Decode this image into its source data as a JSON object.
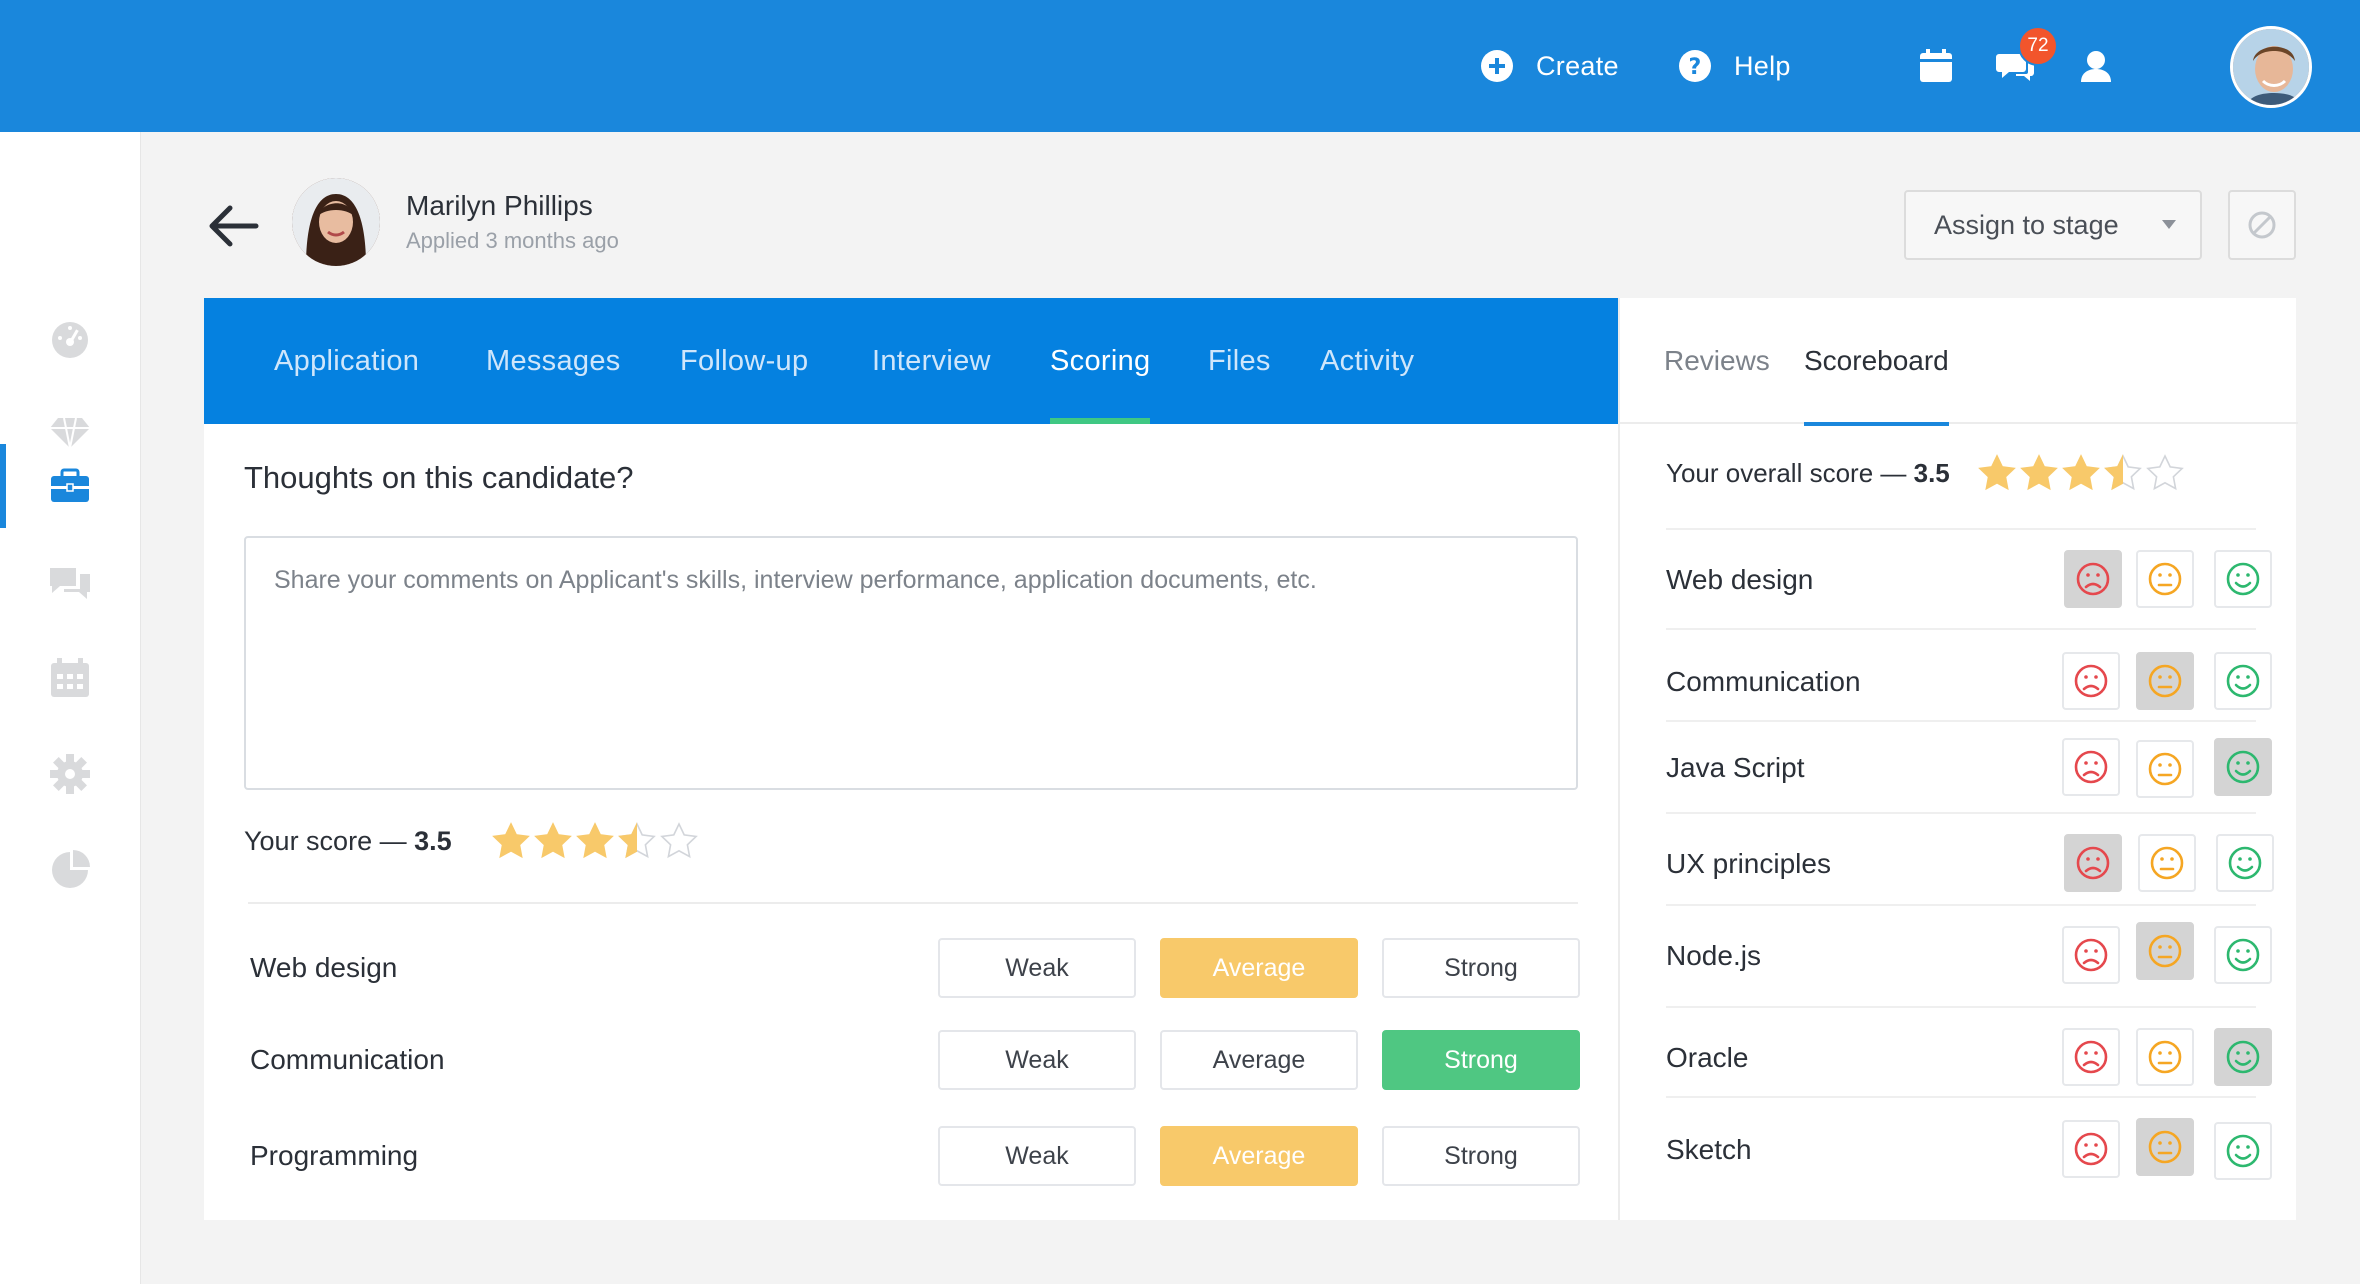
{
  "topbar": {
    "create_label": "Create",
    "help_label": "Help",
    "notification_count": "72"
  },
  "candidate": {
    "name": "Marilyn Phillips",
    "applied": "Applied 3 months ago"
  },
  "header_actions": {
    "assign_label": "Assign to stage"
  },
  "tabs": [
    {
      "label": "Application"
    },
    {
      "label": "Messages"
    },
    {
      "label": "Follow-up"
    },
    {
      "label": "Interview"
    },
    {
      "label": "Scoring",
      "active": true
    },
    {
      "label": "Files"
    },
    {
      "label": "Activity"
    }
  ],
  "scoring": {
    "thoughts_title": "Thoughts on this candidate?",
    "comment_placeholder": "Share your comments on Applicant's skills, interview performance, application documents, etc.",
    "score_prefix": "Your score — ",
    "score_value": "3.5",
    "rating": 3.5,
    "option_labels": {
      "weak": "Weak",
      "average": "Average",
      "strong": "Strong"
    },
    "criteria": [
      {
        "name": "Web design",
        "selected": "average"
      },
      {
        "name": "Communication",
        "selected": "strong"
      },
      {
        "name": "Programming",
        "selected": "average"
      }
    ]
  },
  "right_panel": {
    "tabs": [
      {
        "label": "Reviews"
      },
      {
        "label": "Scoreboard",
        "active": true
      }
    ],
    "overall_prefix": "Your overall score — ",
    "overall_value": "3.5",
    "rating": 3.5,
    "rows": [
      {
        "name": "Web design",
        "selected": "sad"
      },
      {
        "name": "Communication",
        "selected": "neutral"
      },
      {
        "name": "Java Script",
        "selected": "happy"
      },
      {
        "name": "UX principles",
        "selected": "sad"
      },
      {
        "name": "Node.js",
        "selected": "neutral"
      },
      {
        "name": "Oracle",
        "selected": "happy"
      },
      {
        "name": "Sketch",
        "selected": "neutral"
      }
    ]
  },
  "colors": {
    "brand_blue": "#1a87dc",
    "tab_bar_blue": "#0581e0",
    "active_tab_underline": "#3fc883",
    "average_selected": "#f8c96a",
    "strong_selected": "#4fc782",
    "star_gold": "#f8c96a",
    "sad_red": "#e5484d",
    "neutral_orange": "#f5a623",
    "happy_green": "#2db86f",
    "badge_red": "#f2552c"
  },
  "icons": {
    "sidebar": [
      "dashboard-icon",
      "diamond-icon",
      "briefcase-icon",
      "chat-icon",
      "calendar-icon",
      "gear-icon",
      "pie-chart-icon"
    ],
    "topbar": [
      "plus-circle-icon",
      "help-circle-icon",
      "calendar-icon",
      "chat-bubbles-icon",
      "user-icon"
    ],
    "faces": [
      "sad-face-icon",
      "neutral-face-icon",
      "happy-face-icon"
    ]
  }
}
